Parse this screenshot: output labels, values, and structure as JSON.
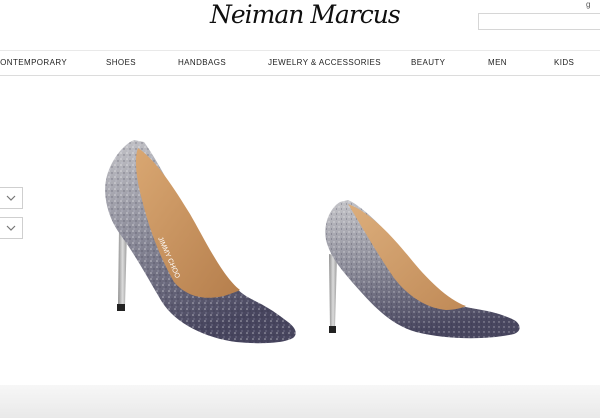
{
  "header": {
    "brand": "Neiman Marcus",
    "search_placeholder": "",
    "account_mark": "g"
  },
  "nav": {
    "items": [
      {
        "id": "contemporary",
        "label": "CONTEMPORARY"
      },
      {
        "id": "shoes",
        "label": "SHOES"
      },
      {
        "id": "handbags",
        "label": "HANDBAGS"
      },
      {
        "id": "jewelry",
        "label": "JEWELRY & ACCESSORIES"
      },
      {
        "id": "beauty",
        "label": "BEAUTY"
      },
      {
        "id": "men",
        "label": "MEN"
      },
      {
        "id": "kids",
        "label": "KIDS"
      }
    ]
  },
  "product": {
    "insole_brand": "JIMMY CHOO",
    "icons": [
      "chevron-down-icon",
      "chevron-down-icon"
    ],
    "colors": {
      "glitter_dark": "#4c4a63",
      "glitter_light": "#b9b9bd",
      "lining": "#c9935e",
      "heel": "#b8b8b8"
    }
  }
}
